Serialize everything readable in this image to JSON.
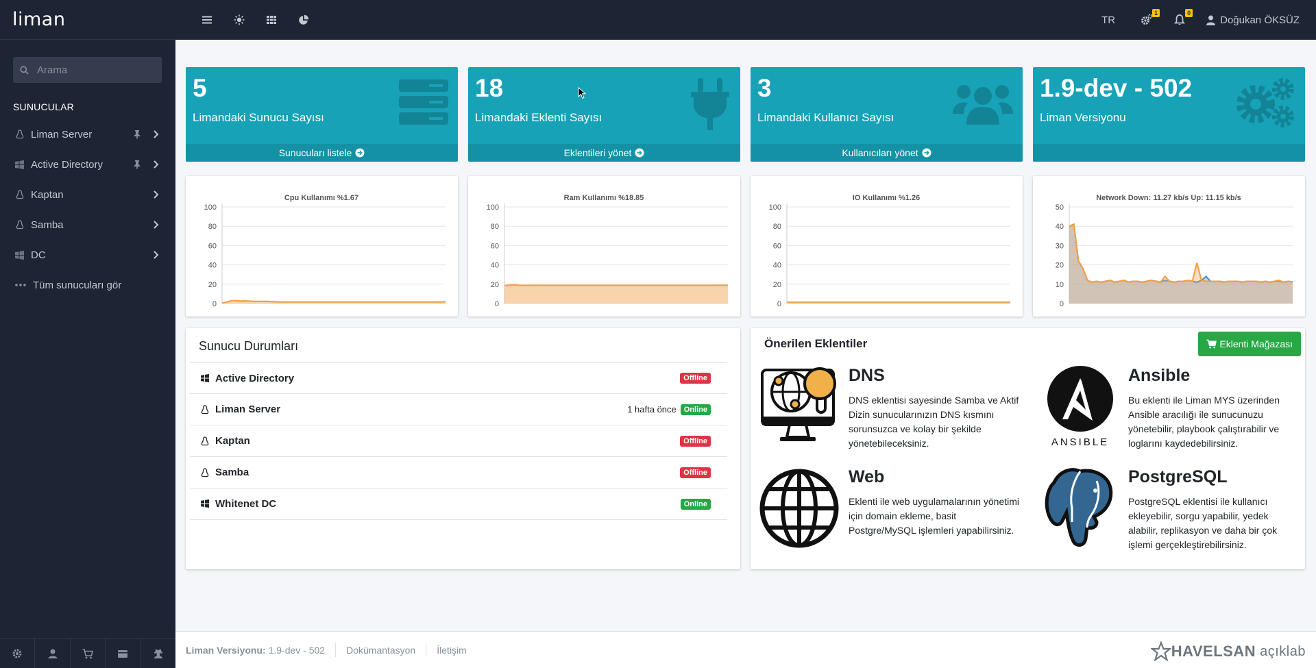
{
  "brand": "liman",
  "search": {
    "placeholder": "Arama"
  },
  "sidebar": {
    "header": "SUNUCULAR",
    "items": [
      {
        "label": "Liman Server",
        "icon": "linux-icon",
        "pinned": true
      },
      {
        "label": "Active Directory",
        "icon": "windows-icon",
        "pinned": true
      },
      {
        "label": "Kaptan",
        "icon": "linux-icon",
        "pinned": false
      },
      {
        "label": "Samba",
        "icon": "linux-icon",
        "pinned": false
      },
      {
        "label": "DC",
        "icon": "windows-icon",
        "pinned": false
      }
    ],
    "all_servers": "Tüm sunucuları gör"
  },
  "topbar": {
    "lang": "TR",
    "settings_badge": "1",
    "notif_badge": "0",
    "user": "Doğukan ÖKSÜZ"
  },
  "stats": [
    {
      "value": "5",
      "label": "Limandaki Sunucu Sayısı",
      "link": "Sunucuları listele"
    },
    {
      "value": "18",
      "label": "Limandaki Eklenti Sayısı",
      "link": "Eklentileri yönet"
    },
    {
      "value": "3",
      "label": "Limandaki Kullanıcı Sayısı",
      "link": "Kullanıcıları yönet"
    },
    {
      "value": "1.9-dev - 502",
      "label": "Liman Versiyonu",
      "link": ""
    }
  ],
  "chart_data": [
    {
      "type": "area",
      "title": "Cpu Kullanımı %1.67",
      "ylim": [
        0,
        100
      ],
      "yticks": [
        0,
        20,
        40,
        60,
        80,
        100
      ],
      "series": [
        {
          "color": "#f0a04a",
          "values": [
            0.5,
            1.5,
            3,
            3,
            2.5,
            2.8,
            2.5,
            2.2,
            2.2,
            2.2,
            2.2,
            2,
            1.8,
            1.6,
            1.6,
            1.6,
            1.6,
            1.6,
            1.6,
            1.6,
            1.6,
            1.6,
            1.6,
            1.6,
            1.6,
            1.6,
            1.6,
            1.6,
            1.6,
            1.6,
            1.6,
            1.6,
            1.6,
            1.6,
            1.6,
            1.6,
            1.6,
            1.6,
            1.6,
            1.6,
            1.6,
            1.6,
            1.6,
            1.6,
            1.6,
            1.6,
            1.6,
            1.6,
            1.6,
            1.67
          ]
        }
      ]
    },
    {
      "type": "area",
      "title": "Ram Kullanımı %18.85",
      "ylim": [
        0,
        100
      ],
      "yticks": [
        0,
        20,
        40,
        60,
        80,
        100
      ],
      "series": [
        {
          "color": "#f0a04a",
          "values": [
            18.5,
            18.9,
            19.5,
            18.9,
            18.7,
            18.7,
            18.8,
            18.8,
            18.8,
            18.8,
            18.8,
            18.8,
            18.8,
            18.8,
            18.8,
            18.8,
            18.8,
            18.8,
            18.8,
            18.8,
            18.8,
            18.8,
            18.8,
            18.8,
            18.8,
            18.8,
            18.8,
            18.8,
            18.8,
            18.8,
            18.8,
            18.8,
            18.8,
            18.8,
            18.8,
            18.8,
            18.8,
            18.8,
            18.8,
            18.8,
            18.8,
            18.8,
            18.8,
            18.8,
            18.8,
            18.8,
            18.8,
            18.8,
            18.85,
            18.85
          ]
        }
      ]
    },
    {
      "type": "area",
      "title": "IO Kullanımı %1.26",
      "ylim": [
        0,
        100
      ],
      "yticks": [
        0,
        20,
        40,
        60,
        80,
        100
      ],
      "series": [
        {
          "color": "#f0a04a",
          "values": [
            1.3,
            1.3,
            1.3,
            1.3,
            1.3,
            1.3,
            1.3,
            1.3,
            1.3,
            1.3,
            1.3,
            1.3,
            1.3,
            1.3,
            1.3,
            1.3,
            1.3,
            1.3,
            1.3,
            1.3,
            1.3,
            1.3,
            1.3,
            1.3,
            1.3,
            1.3,
            1.3,
            1.3,
            1.3,
            1.3,
            1.3,
            1.3,
            1.3,
            1.3,
            1.3,
            1.3,
            1.3,
            1.3,
            1.3,
            1.3,
            1.3,
            1.3,
            1.3,
            1.3,
            1.3,
            1.3,
            1.3,
            1.3,
            1.3,
            1.26
          ]
        }
      ]
    },
    {
      "type": "area",
      "title": "Network Down: 11.27 kb/s Up: 11.15 kb/s",
      "ylim": [
        0,
        50
      ],
      "yticks": [
        0,
        10,
        20,
        30,
        40,
        50
      ],
      "series": [
        {
          "color": "#4a90d9",
          "values": [
            40,
            41,
            22,
            18,
            12,
            11,
            11.5,
            11,
            11.5,
            12,
            11,
            11.5,
            12,
            11,
            11.5,
            11.5,
            11,
            11.5,
            12,
            11.5,
            11,
            12,
            11.5,
            11,
            11.5,
            11.5,
            12,
            11.5,
            11,
            12,
            14,
            11.5,
            11.5,
            11.5,
            11,
            11.5,
            11.5,
            11.5,
            11,
            11.5,
            11.5,
            11.5,
            11,
            11.5,
            11,
            11.5,
            11.5,
            11,
            11.5,
            11.15
          ]
        },
        {
          "color": "#f0a04a",
          "values": [
            40,
            41,
            22,
            18,
            12,
            11,
            11.5,
            11,
            11.5,
            12,
            11,
            11.5,
            12,
            11,
            11.5,
            11.5,
            11,
            11.5,
            12,
            11.5,
            11,
            14,
            11.5,
            11,
            11.5,
            11.5,
            12,
            11.5,
            21,
            12,
            11.5,
            11.5,
            11.5,
            11.5,
            11,
            11.5,
            11.5,
            11.5,
            11,
            11.5,
            11.5,
            11.5,
            11,
            11.5,
            11,
            11.5,
            12,
            11,
            11.5,
            11.27
          ]
        }
      ]
    }
  ],
  "server_status": {
    "title": "Sunucu Durumları",
    "rows": [
      {
        "name": "Active Directory",
        "os": "windows-icon",
        "ago": "",
        "status": "Offline"
      },
      {
        "name": "Liman Server",
        "os": "linux-icon",
        "ago": "1 hafta önce",
        "status": "Online"
      },
      {
        "name": "Kaptan",
        "os": "linux-icon",
        "ago": "",
        "status": "Offline"
      },
      {
        "name": "Samba",
        "os": "linux-icon",
        "ago": "",
        "status": "Offline"
      },
      {
        "name": "Whitenet DC",
        "os": "windows-icon",
        "ago": "",
        "status": "Online"
      }
    ]
  },
  "extensions": {
    "title": "Önerilen Eklentiler",
    "store_button": "Eklenti Mağazası",
    "ansible_logo_text": "ANSIBLE",
    "items": [
      {
        "name": "DNS",
        "desc": "DNS eklentisi sayesinde Samba ve Aktif Dizin sunucularınızın DNS kısmını sorunsuzca ve kolay bir şekilde yönetebileceksiniz."
      },
      {
        "name": "Ansible",
        "desc": "Bu eklenti ile Liman MYS üzerinden Ansible aracılığı ile sunucunuzu yönetebilir, playbook çalıştırabilir ve loglarını kaydedebilirsiniz."
      },
      {
        "name": "Web",
        "desc": "Eklenti ile web uygulamalarının yönetimi için domain ekleme, basit Postgre/MySQL işlemleri yapabilirsiniz."
      },
      {
        "name": "PostgreSQL",
        "desc": "PostgreSQL eklentisi ile kullanıcı ekleyebilir, sorgu yapabilir, yedek alabilir, replikasyon ve daha bir çok işlemi gerçekleştirebilirsiniz."
      }
    ]
  },
  "footer": {
    "version_label": "Liman Versiyonu:",
    "version": "1.9-dev - 502",
    "docs": "Dokümantasyon",
    "contact": "İletişim",
    "company": "HAVELSAN",
    "company_suffix": "açıklab"
  },
  "colors": {
    "sidebar": "#1d2433",
    "info": "#17a2b8",
    "success": "#28a745",
    "danger": "#dc3545",
    "chart_orange": "#f0a04a",
    "chart_blue": "#4a90d9"
  }
}
